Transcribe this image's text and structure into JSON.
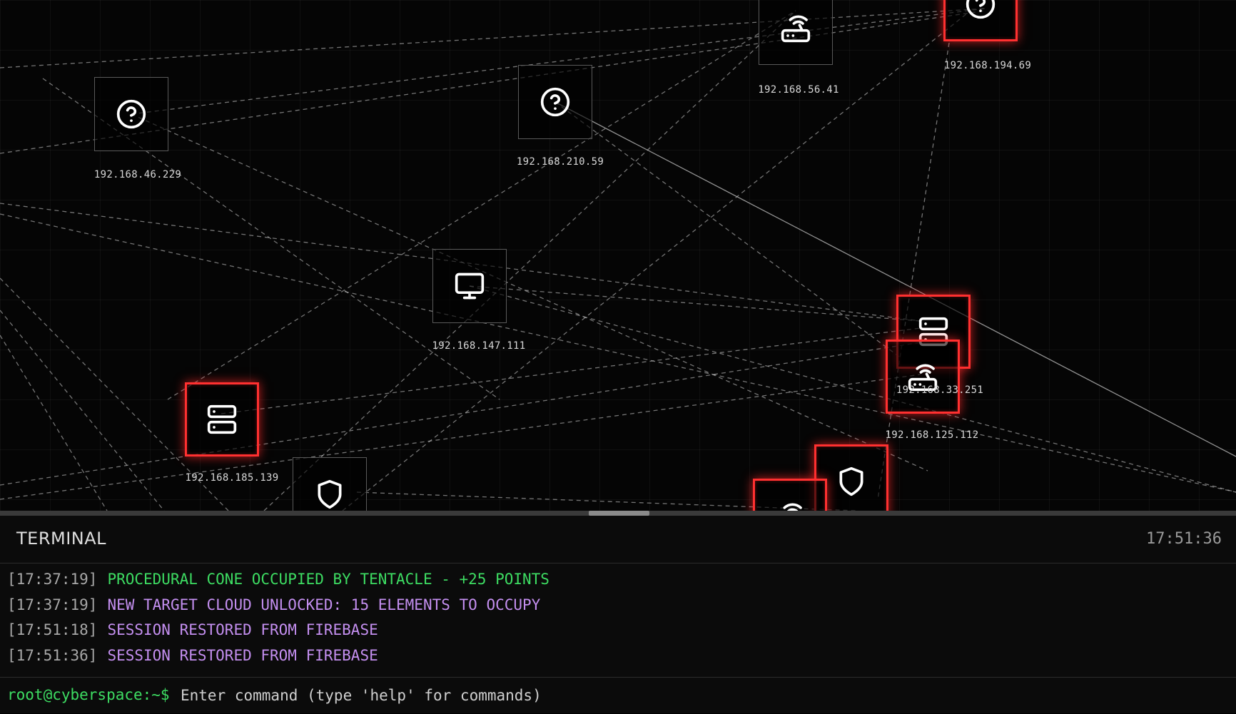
{
  "network": {
    "nodes": [
      {
        "id": "n1",
        "ip": "192.168.46.229",
        "icon": "help-circle-icon",
        "occupied": false
      },
      {
        "id": "n2",
        "ip": "192.168.210.59",
        "icon": "help-circle-icon",
        "occupied": false
      },
      {
        "id": "n3",
        "ip": "192.168.56.41",
        "icon": "router-icon",
        "occupied": false
      },
      {
        "id": "n4",
        "ip": "192.168.194.69",
        "icon": "help-circle-icon",
        "occupied": true
      },
      {
        "id": "n5",
        "ip": "192.168.147.111",
        "icon": "monitor-icon",
        "occupied": false
      },
      {
        "id": "n6",
        "ip": "192.168.185.139",
        "icon": "server-icon",
        "occupied": true
      },
      {
        "id": "n7",
        "ip": "192.168.33.251",
        "icon": "server-icon",
        "occupied": true
      },
      {
        "id": "n8",
        "ip": "192.168.125.112",
        "icon": "router-icon",
        "occupied": true
      },
      {
        "id": "n9",
        "ip": "",
        "icon": "shield-icon",
        "occupied": false
      },
      {
        "id": "n10",
        "ip": "",
        "icon": "shield-icon",
        "occupied": true
      },
      {
        "id": "n11",
        "ip": "",
        "icon": "router-icon",
        "occupied": true
      }
    ],
    "colors": {
      "occupied_border": "#ff3030",
      "idle_border": "#5a5a5a",
      "link": "#cfcfcf"
    }
  },
  "terminal": {
    "title": "TERMINAL",
    "clock": "17:51:36",
    "log": [
      {
        "time": "[17:37:19]",
        "message": "PROCEDURAL CONE OCCUPIED BY TENTACLE - +25 POINTS",
        "type": "success"
      },
      {
        "time": "[17:37:19]",
        "message": "NEW TARGET CLOUD UNLOCKED: 15 ELEMENTS TO OCCUPY",
        "type": "info"
      },
      {
        "time": "[17:51:18]",
        "message": "SESSION RESTORED FROM FIREBASE",
        "type": "info"
      },
      {
        "time": "[17:51:36]",
        "message": "SESSION RESTORED FROM FIREBASE",
        "type": "info"
      }
    ],
    "prompt": "root@cyberspace:~$",
    "input_placeholder": "Enter command (type 'help' for commands)",
    "input_value": ""
  }
}
